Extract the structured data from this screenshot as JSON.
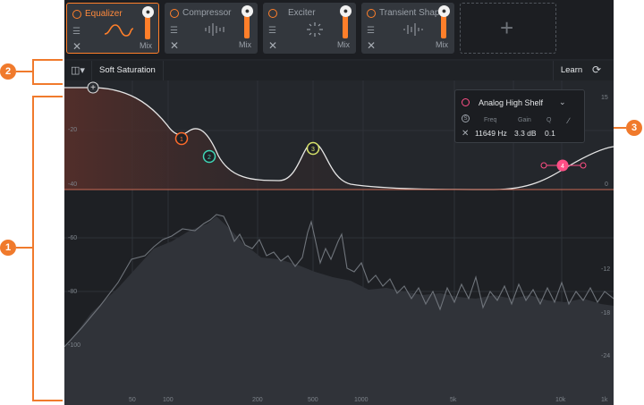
{
  "modules": [
    {
      "title": "Equalizer",
      "mix_label": "Mix",
      "active": true
    },
    {
      "title": "Compressor",
      "mix_label": "Mix",
      "active": false
    },
    {
      "title": "Exciter",
      "mix_label": "Mix",
      "active": false
    },
    {
      "title": "Transient Shaper",
      "mix_label": "Mix",
      "active": false
    }
  ],
  "add_module_icon": "plus-icon",
  "toolbar": {
    "preset": "Soft Saturation",
    "learn_label": "Learn"
  },
  "band_popup": {
    "filter_type": "Analog High Shelf",
    "headers": {
      "freq": "Freq",
      "gain": "Gain",
      "q": "Q"
    },
    "values": {
      "freq": "11649 Hz",
      "gain": "3.3 dB",
      "q": "0.1"
    }
  },
  "band_markers": [
    "1",
    "2",
    "3",
    "4"
  ],
  "eq_db_labels": [
    "-20",
    "-40"
  ],
  "right_scale_labels": [
    "15",
    "0",
    "-12",
    "-18",
    "-24"
  ],
  "spectrum_db_labels": [
    "-60",
    "-80",
    "-100"
  ],
  "freq_labels": [
    "50",
    "100",
    "200",
    "500",
    "1000",
    "5k",
    "10k",
    "1k"
  ],
  "callouts": [
    "1",
    "2",
    "3"
  ],
  "colors": {
    "accent": "#ff7f2a",
    "band1": "#ff6a2b",
    "band2": "#3fd6b6",
    "band3": "#d8e36a",
    "band4": "#ff4f86"
  }
}
